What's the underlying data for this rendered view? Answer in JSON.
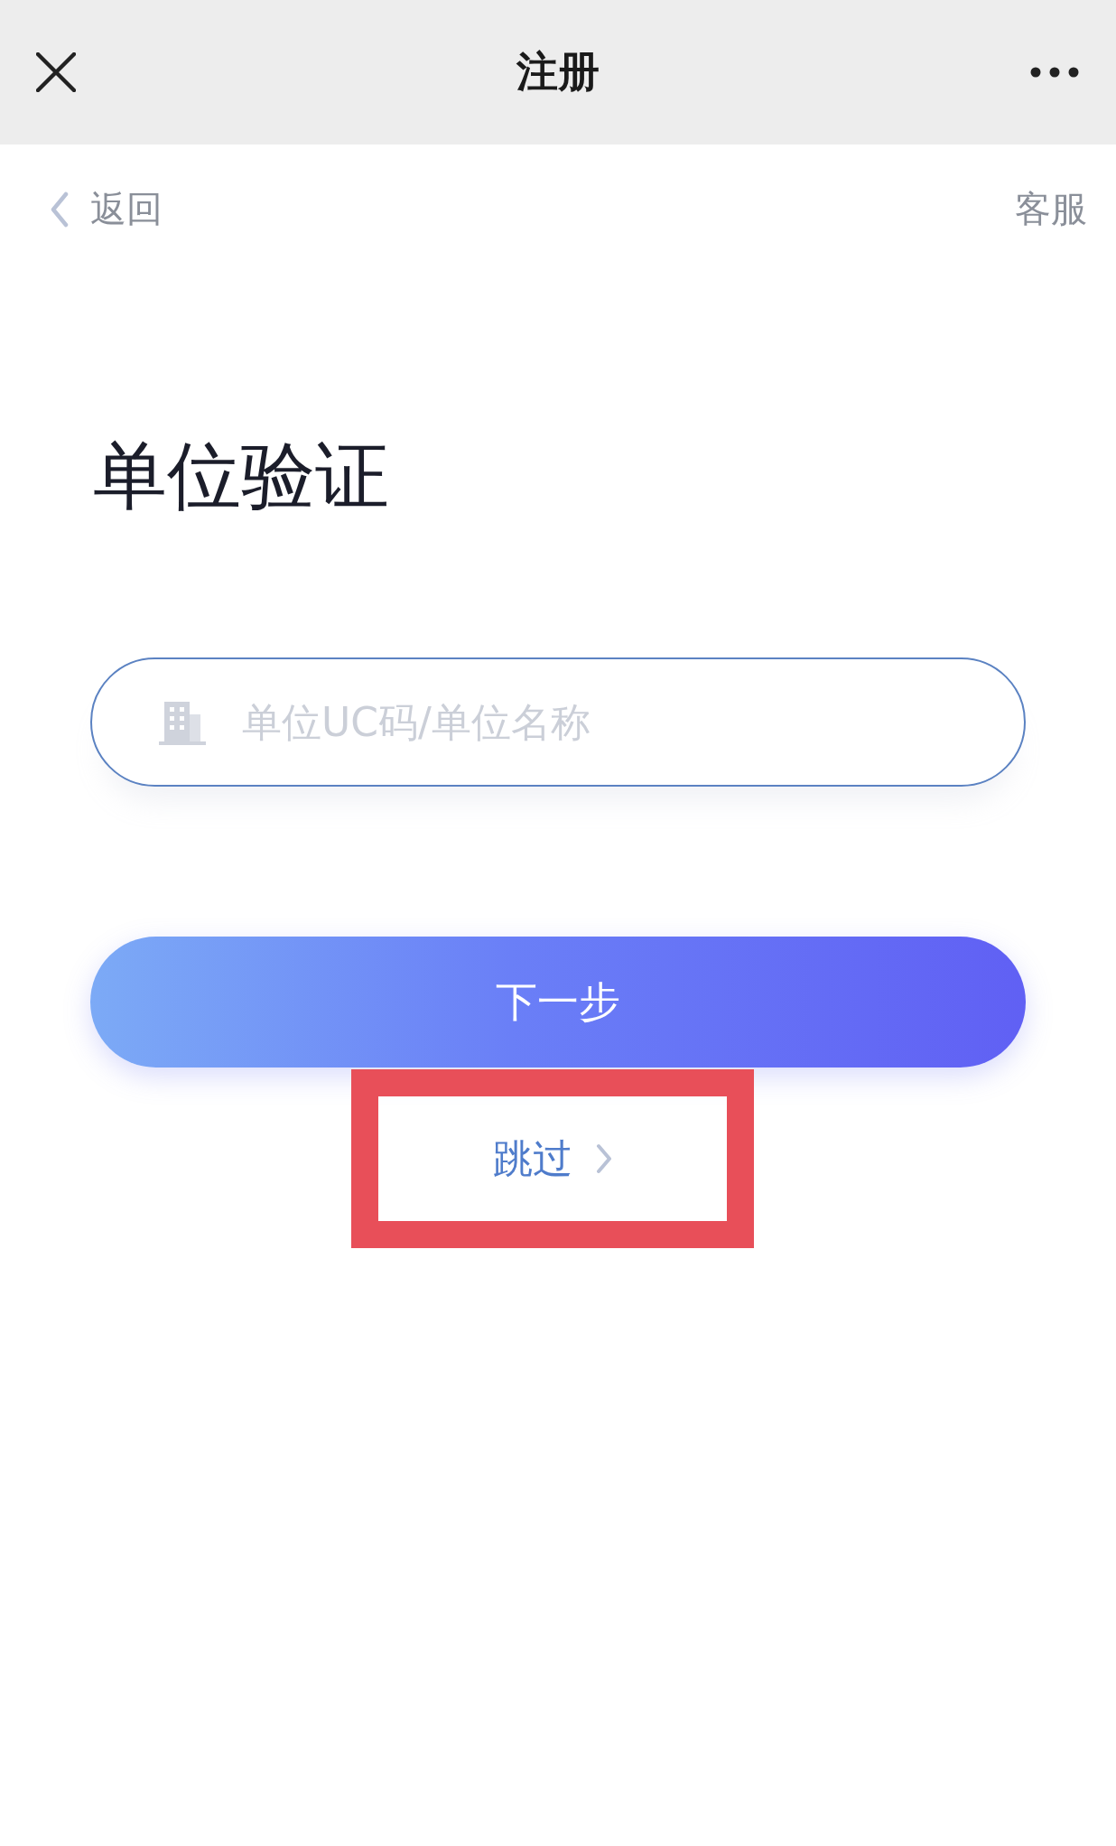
{
  "top_bar": {
    "title": "注册"
  },
  "nav": {
    "back": "返回",
    "service": "客服"
  },
  "heading": "单位验证",
  "search": {
    "placeholder": "单位UC码/单位名称"
  },
  "next_button": "下一步",
  "skip_link": {
    "label": "跳过",
    "highlighted": true
  }
}
